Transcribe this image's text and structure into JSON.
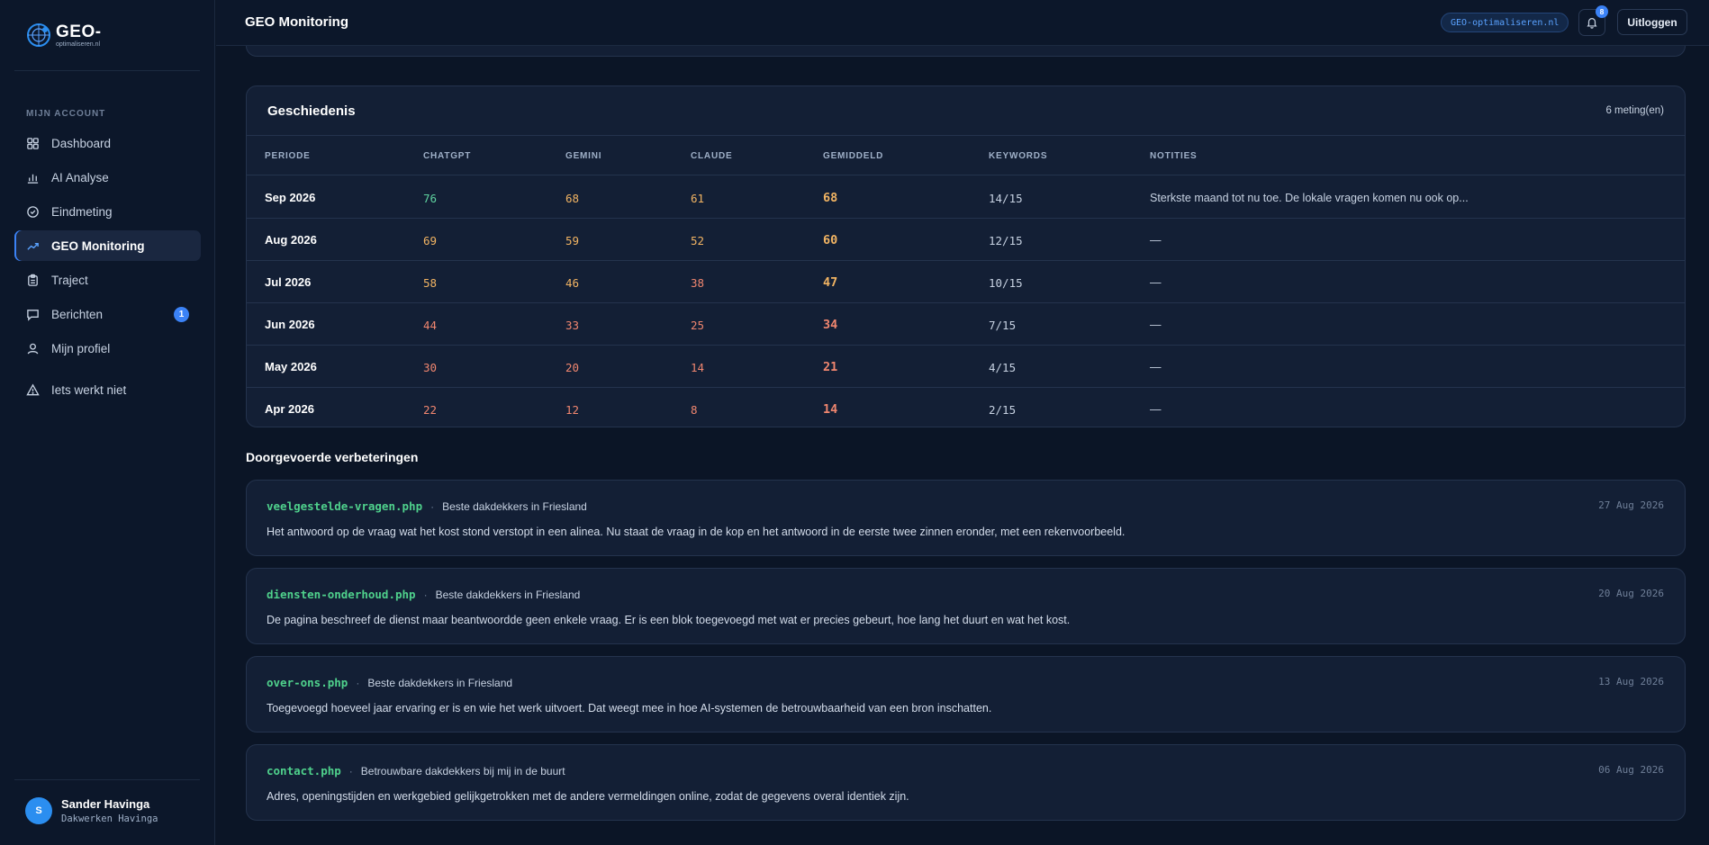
{
  "brand": {
    "logo_main": "GEO-",
    "logo_sub": "optimaliseren.nl"
  },
  "sidebar": {
    "section_label": "MIJN ACCOUNT",
    "items": [
      {
        "label": "Dashboard",
        "icon": "grid-icon"
      },
      {
        "label": "AI Analyse",
        "icon": "bar-chart-icon"
      },
      {
        "label": "Eindmeting",
        "icon": "check-circle-icon"
      },
      {
        "label": "GEO Monitoring",
        "icon": "trending-up-icon",
        "active": true
      },
      {
        "label": "Traject",
        "icon": "clipboard-icon"
      },
      {
        "label": "Berichten",
        "icon": "message-icon",
        "badge": "1"
      },
      {
        "label": "Mijn profiel",
        "icon": "user-icon"
      },
      {
        "label": "Iets werkt niet",
        "icon": "warning-icon"
      }
    ],
    "user": {
      "initial": "S",
      "name": "Sander Havinga",
      "company": "Dakwerken Havinga"
    }
  },
  "header": {
    "title": "GEO Monitoring",
    "domain": "GEO-optimaliseren.nl",
    "notifications_count": "8",
    "logout_label": "Uitloggen"
  },
  "history": {
    "title": "Geschiedenis",
    "count": "6 meting(en)",
    "columns": [
      "PERIODE",
      "CHATGPT",
      "GEMINI",
      "CLAUDE",
      "GEMIDDELD",
      "KEYWORDS",
      "NOTITIES"
    ],
    "rows": [
      {
        "period": "Sep 2026",
        "chatgpt": "76",
        "gemini": "68",
        "claude": "61",
        "avg": "68",
        "keywords": "14/15",
        "notes": "Sterkste maand tot nu toe. De lokale vragen komen nu ook op..."
      },
      {
        "period": "Aug 2026",
        "chatgpt": "69",
        "gemini": "59",
        "claude": "52",
        "avg": "60",
        "keywords": "12/15",
        "notes": "—"
      },
      {
        "period": "Jul 2026",
        "chatgpt": "58",
        "gemini": "46",
        "claude": "38",
        "avg": "47",
        "keywords": "10/15",
        "notes": "—"
      },
      {
        "period": "Jun 2026",
        "chatgpt": "44",
        "gemini": "33",
        "claude": "25",
        "avg": "34",
        "keywords": "7/15",
        "notes": "—"
      },
      {
        "period": "May 2026",
        "chatgpt": "30",
        "gemini": "20",
        "claude": "14",
        "avg": "21",
        "keywords": "4/15",
        "notes": "—"
      },
      {
        "period": "Apr 2026",
        "chatgpt": "22",
        "gemini": "12",
        "claude": "8",
        "avg": "14",
        "keywords": "2/15",
        "notes": "—"
      }
    ]
  },
  "improvements": {
    "title": "Doorgevoerde verbeteringen",
    "items": [
      {
        "file": "veelgestelde-vragen.php",
        "keyword": "Beste dakdekkers in Friesland",
        "date": "27 Aug 2026",
        "description": "Het antwoord op de vraag wat het kost stond verstopt in een alinea. Nu staat de vraag in de kop en het antwoord in de eerste twee zinnen eronder, met een rekenvoorbeeld."
      },
      {
        "file": "diensten-onderhoud.php",
        "keyword": "Beste dakdekkers in Friesland",
        "date": "20 Aug 2026",
        "description": "De pagina beschreef de dienst maar beantwoordde geen enkele vraag. Er is een blok toegevoegd met wat er precies gebeurt, hoe lang het duurt en wat het kost."
      },
      {
        "file": "over-ons.php",
        "keyword": "Beste dakdekkers in Friesland",
        "date": "13 Aug 2026",
        "description": "Toegevoegd hoeveel jaar ervaring er is en wie het werk uitvoert. Dat weegt mee in hoe AI-systemen de betrouwbaarheid van een bron inschatten."
      },
      {
        "file": "contact.php",
        "keyword": "Betrouwbare dakdekkers bij mij in de buurt",
        "date": "06 Aug 2026",
        "description": "Adres, openingstijden en werkgebied gelijkgetrokken met de andere vermeldingen online, zodat de gegevens overal identiek zijn."
      }
    ]
  },
  "colors": {
    "score_high": "#5fd3a0",
    "score_mid": "#f2b463",
    "score_low": "#f0866f",
    "file_green": "#4fd18c",
    "accent": "#3b82f6"
  }
}
